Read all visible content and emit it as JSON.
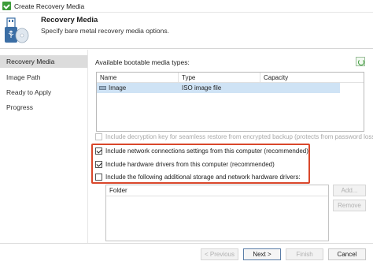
{
  "window": {
    "title": "Create Recovery Media"
  },
  "header": {
    "title": "Recovery Media",
    "subtitle": "Specify bare metal recovery media options."
  },
  "steps": [
    {
      "label": "Recovery Media",
      "active": true
    },
    {
      "label": "Image Path",
      "active": false
    },
    {
      "label": "Ready to Apply",
      "active": false
    },
    {
      "label": "Progress",
      "active": false
    }
  ],
  "media": {
    "label": "Available bootable media types:",
    "columns": [
      "Name",
      "Type",
      "Capacity"
    ],
    "rows": [
      {
        "name": "Image",
        "type": "ISO image file",
        "capacity": ""
      }
    ]
  },
  "options": {
    "decryption_key": {
      "label": "Include decryption key for seamless restore from encrypted backup (protects from password loss)",
      "checked": false,
      "enabled": false
    },
    "network_settings": {
      "label": "Include network connections settings from this computer (recommended)",
      "checked": true,
      "enabled": true
    },
    "hardware_drivers": {
      "label": "Include hardware drivers from this computer (recommended)",
      "checked": true,
      "enabled": true
    },
    "additional_drivers": {
      "label": "Include the following additional storage and network hardware drivers:",
      "checked": false,
      "enabled": true
    }
  },
  "drivers_list": {
    "column": "Folder"
  },
  "buttons": {
    "add": "Add...",
    "remove": "Remove",
    "previous": "< Previous",
    "next": "Next >",
    "finish": "Finish",
    "cancel": "Cancel"
  },
  "colors": {
    "highlight": "#d9472b",
    "selected_row": "#cfe3f5",
    "active_step": "#dcdcdc"
  }
}
